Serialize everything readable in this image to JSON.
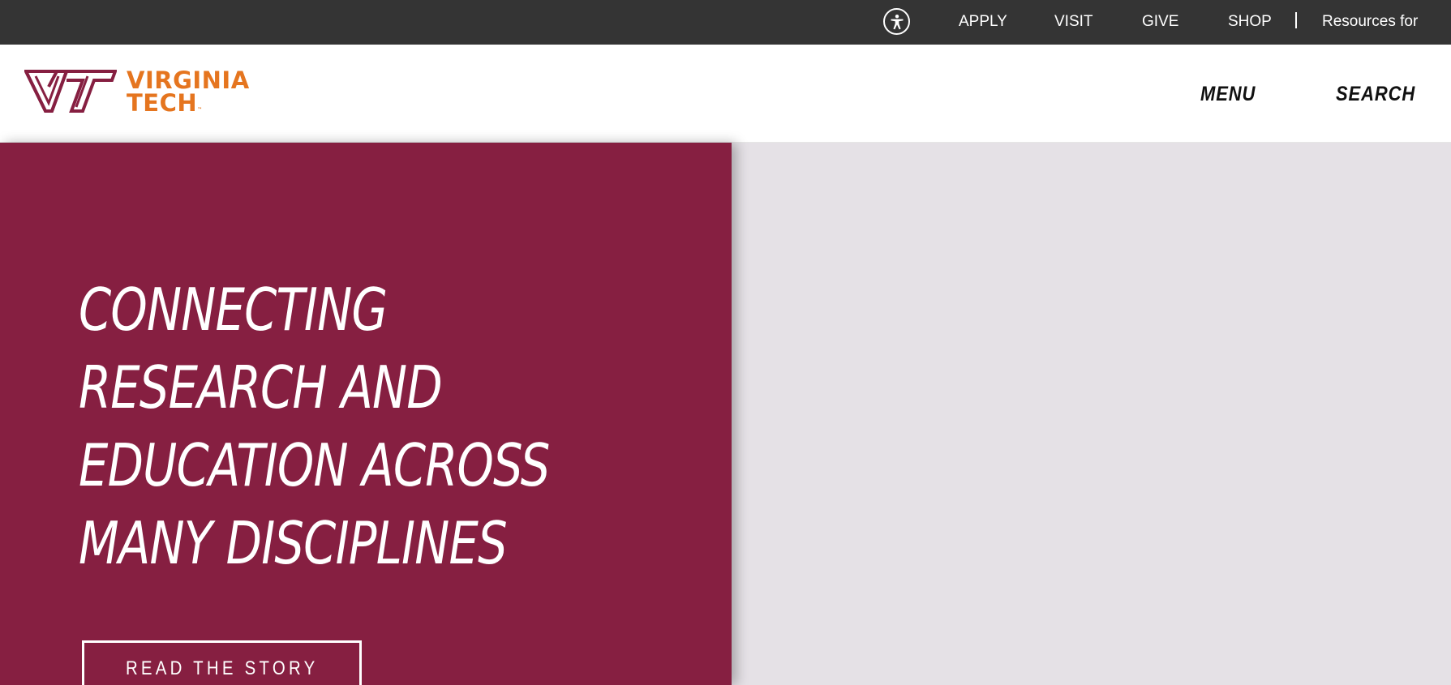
{
  "utility_nav": {
    "accessibility_icon": "accessibility-person-icon",
    "links": [
      "APPLY",
      "VISIT",
      "GIVE",
      "SHOP"
    ],
    "resources_label": "Resources for"
  },
  "header": {
    "logo": {
      "line1": "VIRGINIA",
      "line2": "TECH",
      "trademark": "™"
    },
    "menu_label": "MENU",
    "search_label": "SEARCH"
  },
  "hero": {
    "headline_lines": [
      "CONNECTING",
      "RESEARCH AND",
      "EDUCATION ACROSS",
      "MANY DISCIPLINES"
    ],
    "cta_label": "READ THE STORY"
  },
  "colors": {
    "utility_bar": "#343434",
    "maroon": "#861f41",
    "orange": "#e5751f",
    "media_placeholder": "#e5e1e6"
  }
}
